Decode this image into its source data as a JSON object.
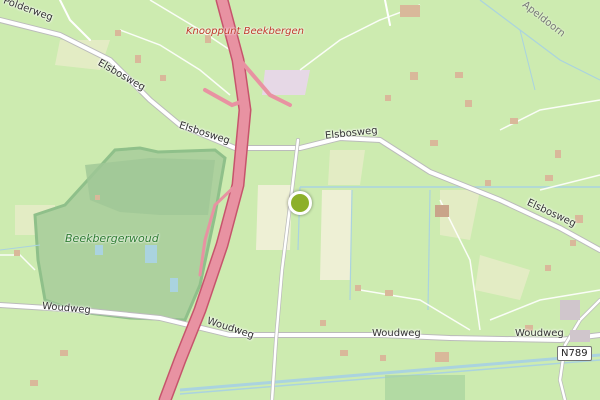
{
  "map": {
    "roads": {
      "elsbosweg_1": "Elsbosweg",
      "elsbosweg_2": "Elsbosweg",
      "elsbosweg_3": "Elsbosweg",
      "elsbosweg_4": "Elsbosweg",
      "woudweg_1": "Woudweg",
      "woudweg_2": "Woudweg",
      "woudweg_3": "Woudweg",
      "woudweg_4": "Woudweg",
      "polderweg": "Polderweg"
    },
    "junction": "Knooppunt Beekbergen",
    "forest": "Beekbergerwoud",
    "place": "Apeldoorn",
    "route_shield": "N789",
    "colors": {
      "land": "#cdebb0",
      "forest": "#add19e",
      "motorway": "#e892a2",
      "road": "#ffffff",
      "water": "#aad3df",
      "marker": "#8db02a"
    }
  }
}
